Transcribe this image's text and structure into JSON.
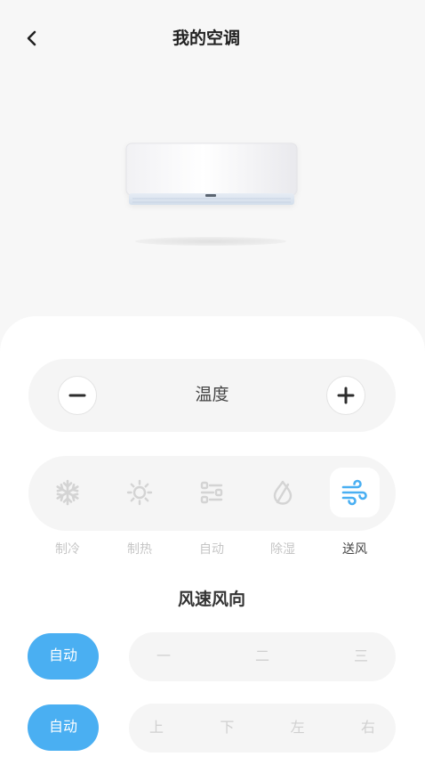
{
  "header": {
    "back_icon": "chevron-left-icon",
    "title": "我的空调"
  },
  "device": {
    "illustration": "air-conditioner-icon"
  },
  "temperature": {
    "label": "温度",
    "decrease_icon": "minus-icon",
    "increase_icon": "plus-icon"
  },
  "modes": [
    {
      "label": "制冷",
      "icon": "snowflake-icon",
      "selected": false
    },
    {
      "label": "制热",
      "icon": "sun-icon",
      "selected": false
    },
    {
      "label": "自动",
      "icon": "sliders-icon",
      "selected": false
    },
    {
      "label": "除湿",
      "icon": "drop-slash-icon",
      "selected": false
    },
    {
      "label": "送风",
      "icon": "wind-icon",
      "selected": true
    }
  ],
  "fan": {
    "title": "风速风向",
    "speed": {
      "auto_label": "自动",
      "auto_selected": true,
      "options": [
        "一",
        "二",
        "三"
      ]
    },
    "direction": {
      "auto_label": "自动",
      "auto_selected": true,
      "options": [
        "上",
        "下",
        "左",
        "右"
      ]
    }
  },
  "colors": {
    "accent": "#4aaff2",
    "background": "#f7f7f7",
    "panel": "#ffffff",
    "control_fill": "#f5f5f5",
    "text_primary": "#333333",
    "text_muted": "#cccccc"
  }
}
